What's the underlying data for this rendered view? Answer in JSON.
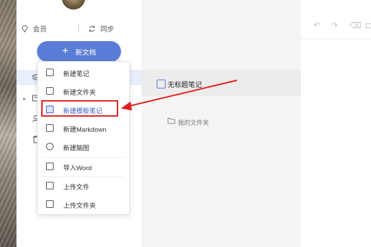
{
  "sidebar": {
    "vip_label": "会员",
    "sync_label": "同步",
    "new_doc_label": "新文档",
    "nav_icons": [
      "layers-icon",
      "document-box-icon",
      "user-icon",
      "trash-icon"
    ]
  },
  "menu": {
    "items": [
      {
        "label": "新建笔记",
        "icon": "new-note-icon"
      },
      {
        "label": "新建文件夹",
        "icon": "folder-icon"
      },
      {
        "label": "新建模板笔记",
        "icon": "template-icon",
        "highlighted": true
      },
      {
        "label": "新建Markdown",
        "icon": "image-icon"
      },
      {
        "label": "新建脑图",
        "icon": "mindmap-icon"
      },
      {
        "label": "导入Word",
        "icon": "import-icon"
      },
      {
        "label": "上传文件",
        "icon": "upload-file-icon"
      },
      {
        "label": "上传文件夹",
        "icon": "upload-folder-icon"
      }
    ]
  },
  "note_list": {
    "note_title": "无标题笔记",
    "folder_label": "我的文件夹"
  },
  "editor": {
    "toolbar_icons": [
      "undo-icon",
      "redo-icon",
      "eraser-icon",
      "format-icon"
    ]
  },
  "colors": {
    "accent": "#5b7cd6",
    "annotation_red": "#e41e1e",
    "selected_bg": "#e8eefb"
  }
}
